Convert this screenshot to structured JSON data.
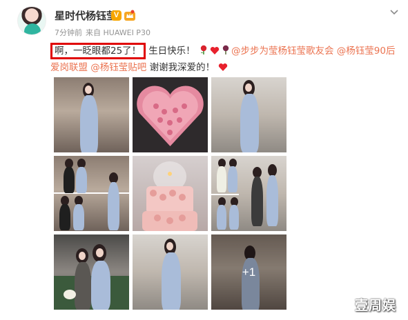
{
  "post": {
    "username": "星时代杨钰莹",
    "verified_badge": "V",
    "meta": {
      "time": "7分钟前",
      "source": "来自 HUAWEI P30"
    },
    "text": {
      "highlight": "啊，一眨眼都25了！",
      "birthday": "生日快乐！",
      "mention_1": "@步步为莹杨钰莹歌友会",
      "mention_2": "@杨钰莹90后",
      "mention_2_cont": "爱岗联盟",
      "mention_3": "@杨钰莹贴吧",
      "thanks": "谢谢我深爱的！"
    },
    "emojis": [
      "rose-icon",
      "heart-icon",
      "wilted-rose-icon",
      "heart-icon"
    ],
    "photos": {
      "count": 9,
      "more_overlay": "+1",
      "items": [
        "photo-woman-standing",
        "photo-heart-roses",
        "photo-woman-posing",
        "photo-group-collage",
        "photo-birthday-cake",
        "photo-fans-collage",
        "photo-two-women-sofa",
        "photo-woman-lobby",
        "photo-woman-hallway"
      ]
    }
  },
  "watermark": "壹周娱",
  "colors": {
    "mention": "#eb7350",
    "highlight_box": "#e00000",
    "meta": "#939393",
    "badge": "#f7a600",
    "dress": "#a9bcd9"
  },
  "icons": [
    "avatar",
    "verified-badge-icon",
    "member-crown-icon",
    "chevron-down-icon"
  ]
}
